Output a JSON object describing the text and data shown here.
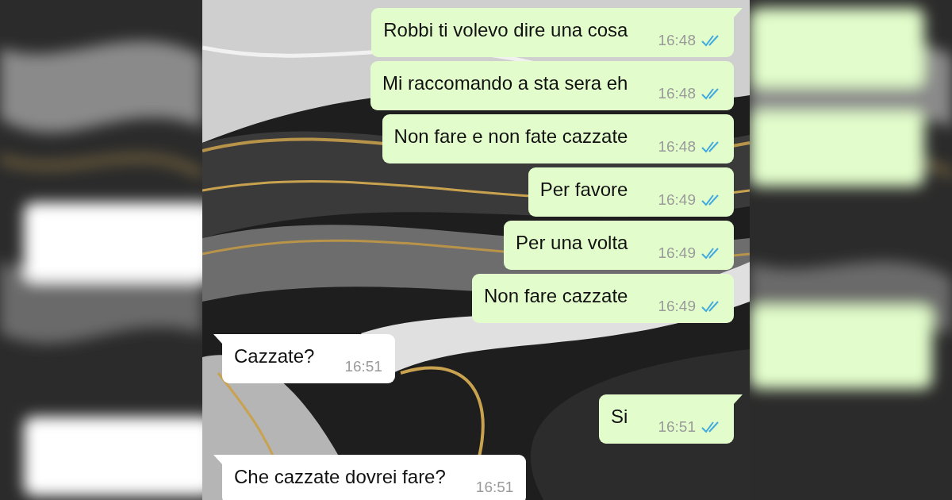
{
  "messages": [
    {
      "kind": "sent",
      "text": "Robbi ti volevo dire una cosa",
      "time": "16:48",
      "read": true,
      "tail": true
    },
    {
      "kind": "sent",
      "text": "Mi raccomando a sta sera eh",
      "time": "16:48",
      "read": true,
      "tail": false
    },
    {
      "kind": "sent",
      "text": "Non fare e non fate cazzate",
      "time": "16:48",
      "read": true,
      "tail": false
    },
    {
      "kind": "sent",
      "text": "Per favore",
      "time": "16:49",
      "read": true,
      "tail": false
    },
    {
      "kind": "sent",
      "text": "Per una volta",
      "time": "16:49",
      "read": true,
      "tail": false
    },
    {
      "kind": "sent",
      "text": "Non fare cazzate",
      "time": "16:49",
      "read": true,
      "tail": false
    },
    {
      "kind": "received",
      "text": "Cazzate?",
      "time": "16:51",
      "tail": true
    },
    {
      "kind": "sent",
      "text": "Si",
      "time": "16:51",
      "read": true,
      "tail": true
    },
    {
      "kind": "received",
      "text": "Che cazzate dovrei fare?",
      "time": "16:51",
      "tail": true
    }
  ]
}
